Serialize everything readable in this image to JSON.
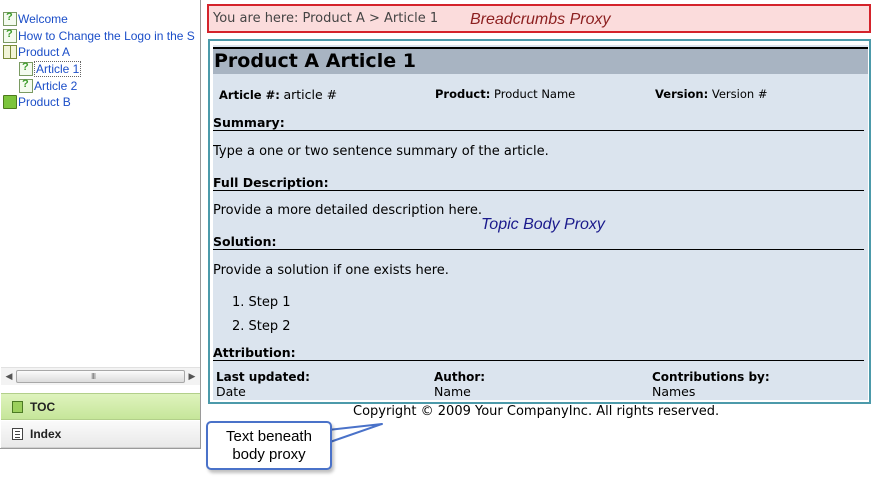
{
  "toc": {
    "items": [
      {
        "label": "Welcome",
        "icon": "topic-page-icon"
      },
      {
        "label": "How to Change the Logo in the S",
        "icon": "topic-page-icon"
      },
      {
        "label": "Product A",
        "icon": "open-book-icon"
      },
      {
        "label": "Article 1",
        "icon": "topic-page-icon",
        "selected": true
      },
      {
        "label": "Article 2",
        "icon": "topic-page-icon"
      },
      {
        "label": "Product B",
        "icon": "closed-book-icon"
      }
    ]
  },
  "scrollbar": {
    "left_arrow": "◀",
    "right_arrow": "▶",
    "grip": "III"
  },
  "nav_tabs": {
    "toc_label": "TOC",
    "index_label": "Index"
  },
  "breadcrumbs": {
    "path": "You are here: Product A > Article 1",
    "proxy_label": "Breadcrumbs Proxy"
  },
  "article": {
    "title": "Product A Article 1",
    "meta": {
      "article_no_label": "Article #:",
      "article_no_value": "article #",
      "product_label": "Product:",
      "product_value": "Product Name",
      "version_label": "Version:",
      "version_value": "Version #"
    },
    "summary_heading": "Summary:",
    "summary_text": "Type a one or two sentence summary of the article.",
    "full_description_heading": "Full Description:",
    "full_description_text": "Provide a more detailed description here.",
    "solution_heading": "Solution:",
    "solution_text": "Provide a solution if one exists here.",
    "steps": [
      "1.  Step 1",
      "2.  Step 2"
    ],
    "attribution_heading": "Attribution:",
    "attribution": {
      "last_updated_label": "Last updated:",
      "last_updated_value": "Date",
      "author_label": "Author:",
      "author_value": "Name",
      "contributions_label": "Contributions by:",
      "contributions_value": "Names"
    },
    "body_proxy_label": "Topic Body Proxy"
  },
  "footer": {
    "copyright": "Copyright © 2009 Your CompanyInc. All rights reserved."
  },
  "callout": {
    "text": "Text beneath body proxy"
  },
  "colors": {
    "toc_link": "#1b4ec8",
    "breadcrumbs_proxy_bg": "#fbdcdc",
    "breadcrumbs_proxy_border": "#d4232b",
    "topic_body_bg": "#dbe4ee",
    "topic_body_border": "#4c9aaa",
    "title_bar_bg": "#a8b4c2",
    "toc_tab_bg": "#c6e69a",
    "callout_border": "#4a72c9"
  }
}
